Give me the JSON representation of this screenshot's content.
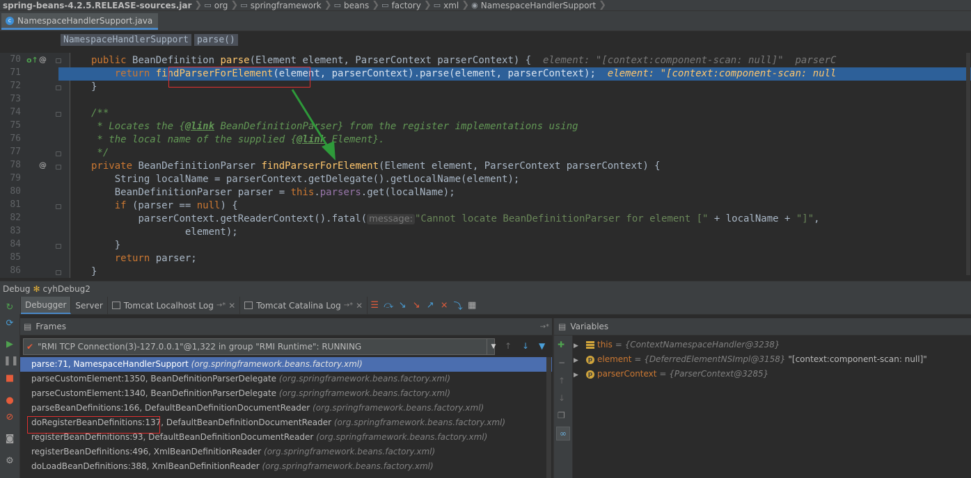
{
  "breadcrumb": {
    "jar": "spring-beans-4.2.5.RELEASE-sources.jar",
    "folders": [
      "org",
      "springframework",
      "beans",
      "factory",
      "xml"
    ],
    "file": "NamespaceHandlerSupport"
  },
  "editor_tab": {
    "label": "NamespaceHandlerSupport.java"
  },
  "code_breadcrumb": {
    "class_name": "NamespaceHandlerSupport",
    "method": "parse()"
  },
  "code": {
    "line_numbers": [
      "70",
      "71",
      "72",
      "73",
      "74",
      "75",
      "76",
      "77",
      "78",
      "79",
      "80",
      "81",
      "82",
      "83",
      "84",
      "85",
      "86"
    ],
    "l70": {
      "kw": "public",
      "type": "BeanDefinition ",
      "name": "parse",
      "rest": "(Element element, ParserContext parserContext) {",
      "hint": "element: \"[context:component-scan: null]\"  parserC"
    },
    "l71": {
      "kw": "return ",
      "call": "findParserForElement",
      "rest": "(element, parserContext).parse(element, parserContext);",
      "hint": "element: \"[context:component-scan: null"
    },
    "l72": "}",
    "l74": "/**",
    "l75": {
      "a": " * Locates the {",
      "tag": "@link",
      "b": " BeanDefinitionParser} from the register implementations using"
    },
    "l76": {
      "a": " * the local name of the supplied {",
      "tag": "@link",
      "b": " Element}."
    },
    "l77": " */",
    "l78": {
      "kw": "private ",
      "type": "BeanDefinitionParser ",
      "name": "findParserForElement",
      "rest": "(Element element, ParserContext parserContext) {"
    },
    "l79": "String localName = parserContext.getDelegate().getLocalName(element);",
    "l80": {
      "a": "BeanDefinitionParser parser = ",
      "kw": "this",
      "b": ".",
      "fld": "parsers",
      "c": ".get(localName);"
    },
    "l81": {
      "kw": "if",
      "a": " (parser == ",
      "kw2": "null",
      "b": ") {"
    },
    "l82": {
      "a": "parserContext.getReaderContext().fatal(",
      "pname": "message:",
      "str": "\"Cannot locate BeanDefinitionParser for element [\"",
      "b": " + localName + ",
      "str2": "\"]\"",
      "c": ","
    },
    "l83": "element);",
    "l84": "}",
    "l85": {
      "kw": "return",
      "a": " parser;"
    },
    "l86": "}"
  },
  "debug": {
    "title": "Debug",
    "config": "cyhDebug2",
    "tabs": [
      "Debugger",
      "Server",
      "Tomcat Localhost Log",
      "Tomcat Catalina Log"
    ],
    "tab_suffix": "→*",
    "frames_title": "Frames",
    "thread": "\"RMI TCP Connection(3)-127.0.0.1\"@1,322 in group \"RMI Runtime\": RUNNING",
    "frames": [
      {
        "method": "parse:71, NamespaceHandlerSupport",
        "pkg": "(org.springframework.beans.factory.xml)"
      },
      {
        "method": "parseCustomElement:1350, BeanDefinitionParserDelegate",
        "pkg": "(org.springframework.beans.factory.xml)"
      },
      {
        "method": "parseCustomElement:1340, BeanDefinitionParserDelegate",
        "pkg": "(org.springframework.beans.factory.xml)"
      },
      {
        "method": "parseBeanDefinitions:166, DefaultBeanDefinitionDocumentReader",
        "pkg": "(org.springframework.beans.factory.xml)"
      },
      {
        "method": "doRegisterBeanDefinitions:137, DefaultBeanDefinitionDocumentReader",
        "pkg": "(org.springframework.beans.factory.xml)"
      },
      {
        "method": "registerBeanDefinitions:93, DefaultBeanDefinitionDocumentReader",
        "pkg": "(org.springframework.beans.factory.xml)"
      },
      {
        "method": "registerBeanDefinitions:496, XmlBeanDefinitionReader",
        "pkg": "(org.springframework.beans.factory.xml)"
      },
      {
        "method": "doLoadBeanDefinitions:388, XmlBeanDefinitionReader",
        "pkg": "(org.springframework.beans.factory.xml)"
      }
    ],
    "variables_title": "Variables",
    "variables": [
      {
        "name": "this",
        "value": "= {ContextNamespaceHandler@3238}",
        "extra": ""
      },
      {
        "name": "element",
        "value": "= {DeferredElementNSImpl@3158}",
        "extra": " \"[context:component-scan: null]\""
      },
      {
        "name": "parserContext",
        "value": "= {ParserContext@3285}",
        "extra": ""
      }
    ]
  },
  "colors": {
    "editor_bg": "#2b2b2b",
    "execution_line": "#2d6099",
    "selected_frame": "#4b6eaf",
    "annotation_red": "#e03030",
    "annotation_arrow": "#2e9a3a"
  }
}
